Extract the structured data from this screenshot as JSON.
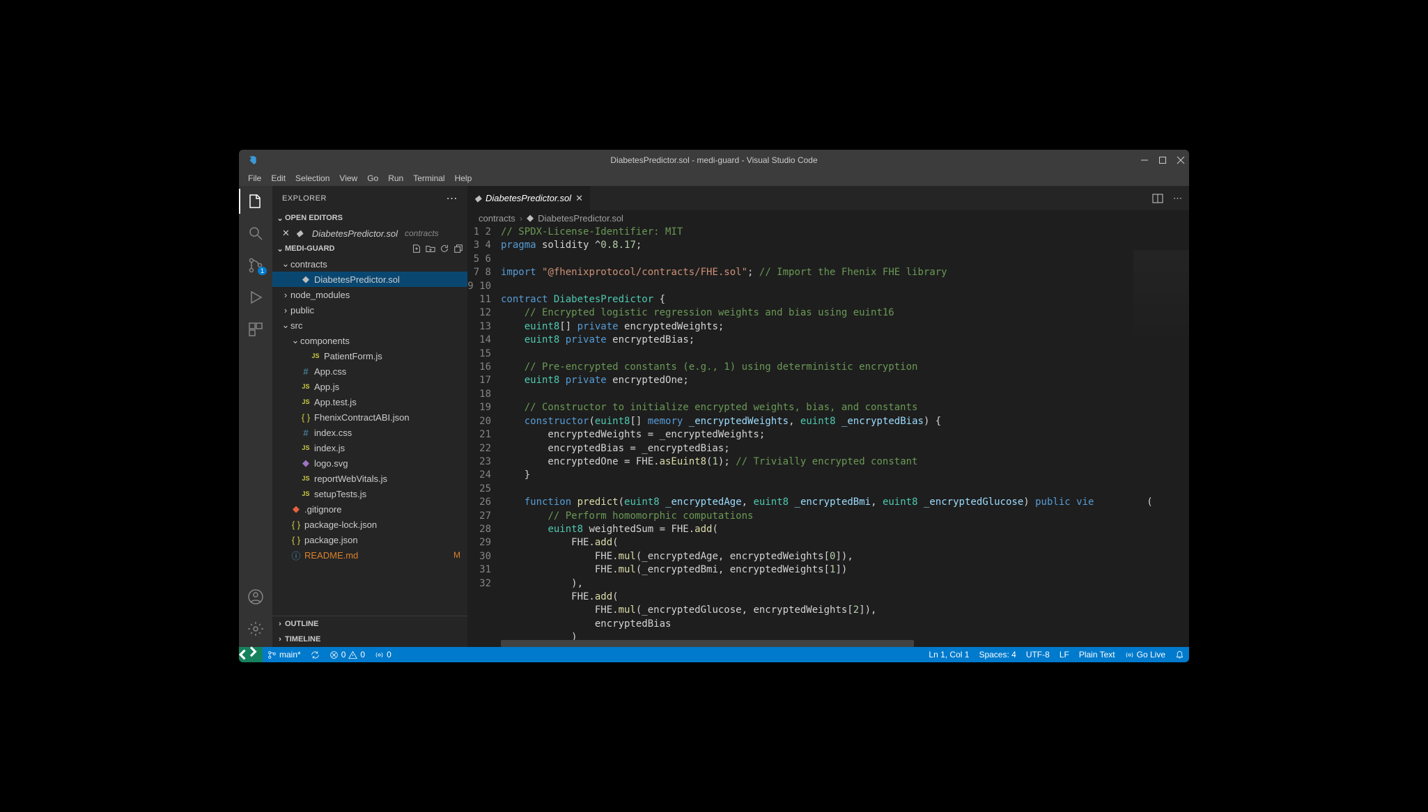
{
  "title": "DiabetesPredictor.sol - medi-guard - Visual Studio Code",
  "menu": [
    "File",
    "Edit",
    "Selection",
    "View",
    "Go",
    "Run",
    "Terminal",
    "Help"
  ],
  "sidebar": {
    "title": "EXPLORER",
    "openEditorsLabel": "OPEN EDITORS",
    "openEditor": {
      "name": "DiabetesPredictor.sol",
      "dir": "contracts"
    },
    "projectName": "MEDI-GUARD",
    "outline": "OUTLINE",
    "timeline": "TIMELINE",
    "scmBadge": "1",
    "tree": [
      {
        "depth": 0,
        "type": "folder",
        "open": true,
        "name": "contracts"
      },
      {
        "depth": 1,
        "type": "file",
        "icon": "sol",
        "name": "DiabetesPredictor.sol",
        "selected": true
      },
      {
        "depth": 0,
        "type": "folder",
        "open": false,
        "name": "node_modules"
      },
      {
        "depth": 0,
        "type": "folder",
        "open": false,
        "name": "public"
      },
      {
        "depth": 0,
        "type": "folder",
        "open": true,
        "name": "src"
      },
      {
        "depth": 1,
        "type": "folder",
        "open": true,
        "name": "components"
      },
      {
        "depth": 2,
        "type": "file",
        "icon": "js",
        "name": "PatientForm.js"
      },
      {
        "depth": 1,
        "type": "file",
        "icon": "hash",
        "name": "App.css"
      },
      {
        "depth": 1,
        "type": "file",
        "icon": "js",
        "name": "App.js"
      },
      {
        "depth": 1,
        "type": "file",
        "icon": "js",
        "name": "App.test.js"
      },
      {
        "depth": 1,
        "type": "file",
        "icon": "json",
        "name": "FhenixContractABI.json"
      },
      {
        "depth": 1,
        "type": "file",
        "icon": "hash",
        "name": "index.css"
      },
      {
        "depth": 1,
        "type": "file",
        "icon": "js",
        "name": "index.js"
      },
      {
        "depth": 1,
        "type": "file",
        "icon": "svg",
        "name": "logo.svg"
      },
      {
        "depth": 1,
        "type": "file",
        "icon": "js",
        "name": "reportWebVitals.js"
      },
      {
        "depth": 1,
        "type": "file",
        "icon": "js",
        "name": "setupTests.js"
      },
      {
        "depth": 0,
        "type": "file",
        "icon": "git",
        "name": ".gitignore"
      },
      {
        "depth": 0,
        "type": "file",
        "icon": "json",
        "name": "package-lock.json"
      },
      {
        "depth": 0,
        "type": "file",
        "icon": "json",
        "name": "package.json"
      },
      {
        "depth": 0,
        "type": "file",
        "icon": "md",
        "name": "README.md",
        "decor": "M"
      }
    ]
  },
  "tab": {
    "name": "DiabetesPredictor.sol"
  },
  "breadcrumb": {
    "folder": "contracts",
    "file": "DiabetesPredictor.sol"
  },
  "code": {
    "lines": [
      [
        [
          "c",
          "// SPDX-License-Identifier: MIT"
        ]
      ],
      [
        [
          "k",
          "pragma"
        ],
        [
          "p",
          " solidity ^"
        ],
        [
          "n",
          "0.8.17"
        ],
        [
          "p",
          ";"
        ]
      ],
      [],
      [
        [
          "k",
          "import"
        ],
        [
          "p",
          " "
        ],
        [
          "s",
          "\"@fhenixprotocol/contracts/FHE.sol\""
        ],
        [
          "p",
          "; "
        ],
        [
          "c",
          "// Import the Fhenix FHE library"
        ]
      ],
      [],
      [
        [
          "k",
          "contract"
        ],
        [
          "p",
          " "
        ],
        [
          "t",
          "DiabetesPredictor"
        ],
        [
          "p",
          " {"
        ]
      ],
      [
        [
          "p",
          "    "
        ],
        [
          "c",
          "// Encrypted logistic regression weights and bias using euint16"
        ]
      ],
      [
        [
          "p",
          "    "
        ],
        [
          "t",
          "euint8"
        ],
        [
          "p",
          "[] "
        ],
        [
          "k",
          "private"
        ],
        [
          "p",
          " encryptedWeights;"
        ]
      ],
      [
        [
          "p",
          "    "
        ],
        [
          "t",
          "euint8"
        ],
        [
          "p",
          " "
        ],
        [
          "k",
          "private"
        ],
        [
          "p",
          " encryptedBias;"
        ]
      ],
      [],
      [
        [
          "p",
          "    "
        ],
        [
          "c",
          "// Pre-encrypted constants (e.g., 1) using deterministic encryption"
        ]
      ],
      [
        [
          "p",
          "    "
        ],
        [
          "t",
          "euint8"
        ],
        [
          "p",
          " "
        ],
        [
          "k",
          "private"
        ],
        [
          "p",
          " encryptedOne;"
        ]
      ],
      [],
      [
        [
          "p",
          "    "
        ],
        [
          "c",
          "// Constructor to initialize encrypted weights, bias, and constants"
        ]
      ],
      [
        [
          "p",
          "    "
        ],
        [
          "k",
          "constructor"
        ],
        [
          "p",
          "("
        ],
        [
          "t",
          "euint8"
        ],
        [
          "p",
          "[] "
        ],
        [
          "k",
          "memory"
        ],
        [
          "p",
          " "
        ],
        [
          "v",
          "_encryptedWeights"
        ],
        [
          "p",
          ", "
        ],
        [
          "t",
          "euint8"
        ],
        [
          "p",
          " "
        ],
        [
          "v",
          "_encryptedBias"
        ],
        [
          "p",
          ") {"
        ]
      ],
      [
        [
          "p",
          "        encryptedWeights = _encryptedWeights;"
        ]
      ],
      [
        [
          "p",
          "        encryptedBias = _encryptedBias;"
        ]
      ],
      [
        [
          "p",
          "        encryptedOne = FHE."
        ],
        [
          "f",
          "asEuint8"
        ],
        [
          "p",
          "("
        ],
        [
          "n",
          "1"
        ],
        [
          "p",
          "); "
        ],
        [
          "c",
          "// Trivially encrypted constant"
        ]
      ],
      [
        [
          "p",
          "    }"
        ]
      ],
      [],
      [
        [
          "p",
          "    "
        ],
        [
          "k",
          "function"
        ],
        [
          "p",
          " "
        ],
        [
          "f",
          "predict"
        ],
        [
          "p",
          "("
        ],
        [
          "t",
          "euint8"
        ],
        [
          "p",
          " "
        ],
        [
          "v",
          "_encryptedAge"
        ],
        [
          "p",
          ", "
        ],
        [
          "t",
          "euint8"
        ],
        [
          "p",
          " "
        ],
        [
          "v",
          "_encryptedBmi"
        ],
        [
          "p",
          ", "
        ],
        [
          "t",
          "euint8"
        ],
        [
          "p",
          " "
        ],
        [
          "v",
          "_encryptedGlucose"
        ],
        [
          "p",
          ") "
        ],
        [
          "k",
          "public"
        ],
        [
          "p",
          " "
        ],
        [
          "k",
          "vie"
        ],
        [
          "p",
          "         ("
        ]
      ],
      [
        [
          "p",
          "        "
        ],
        [
          "c",
          "// Perform homomorphic computations"
        ]
      ],
      [
        [
          "p",
          "        "
        ],
        [
          "t",
          "euint8"
        ],
        [
          "p",
          " weightedSum = FHE."
        ],
        [
          "f",
          "add"
        ],
        [
          "p",
          "("
        ]
      ],
      [
        [
          "p",
          "            FHE."
        ],
        [
          "f",
          "add"
        ],
        [
          "p",
          "("
        ]
      ],
      [
        [
          "p",
          "                FHE."
        ],
        [
          "f",
          "mul"
        ],
        [
          "p",
          "(_encryptedAge, encryptedWeights["
        ],
        [
          "n",
          "0"
        ],
        [
          "p",
          "]),"
        ]
      ],
      [
        [
          "p",
          "                FHE."
        ],
        [
          "f",
          "mul"
        ],
        [
          "p",
          "(_encryptedBmi, encryptedWeights["
        ],
        [
          "n",
          "1"
        ],
        [
          "p",
          "])"
        ]
      ],
      [
        [
          "p",
          "            ),"
        ]
      ],
      [
        [
          "p",
          "            FHE."
        ],
        [
          "f",
          "add"
        ],
        [
          "p",
          "("
        ]
      ],
      [
        [
          "p",
          "                FHE."
        ],
        [
          "f",
          "mul"
        ],
        [
          "p",
          "(_encryptedGlucose, encryptedWeights["
        ],
        [
          "n",
          "2"
        ],
        [
          "p",
          "]),"
        ]
      ],
      [
        [
          "p",
          "                encryptedBias"
        ]
      ],
      [
        [
          "p",
          "            )"
        ]
      ],
      [
        [
          "p",
          "        );"
        ]
      ]
    ]
  },
  "status": {
    "branch": "main*",
    "errors": "0",
    "warnings": "0",
    "port": "0",
    "lineCol": "Ln 1, Col 1",
    "spaces": "Spaces: 4",
    "encoding": "UTF-8",
    "eol": "LF",
    "lang": "Plain Text",
    "goLive": "Go Live"
  }
}
